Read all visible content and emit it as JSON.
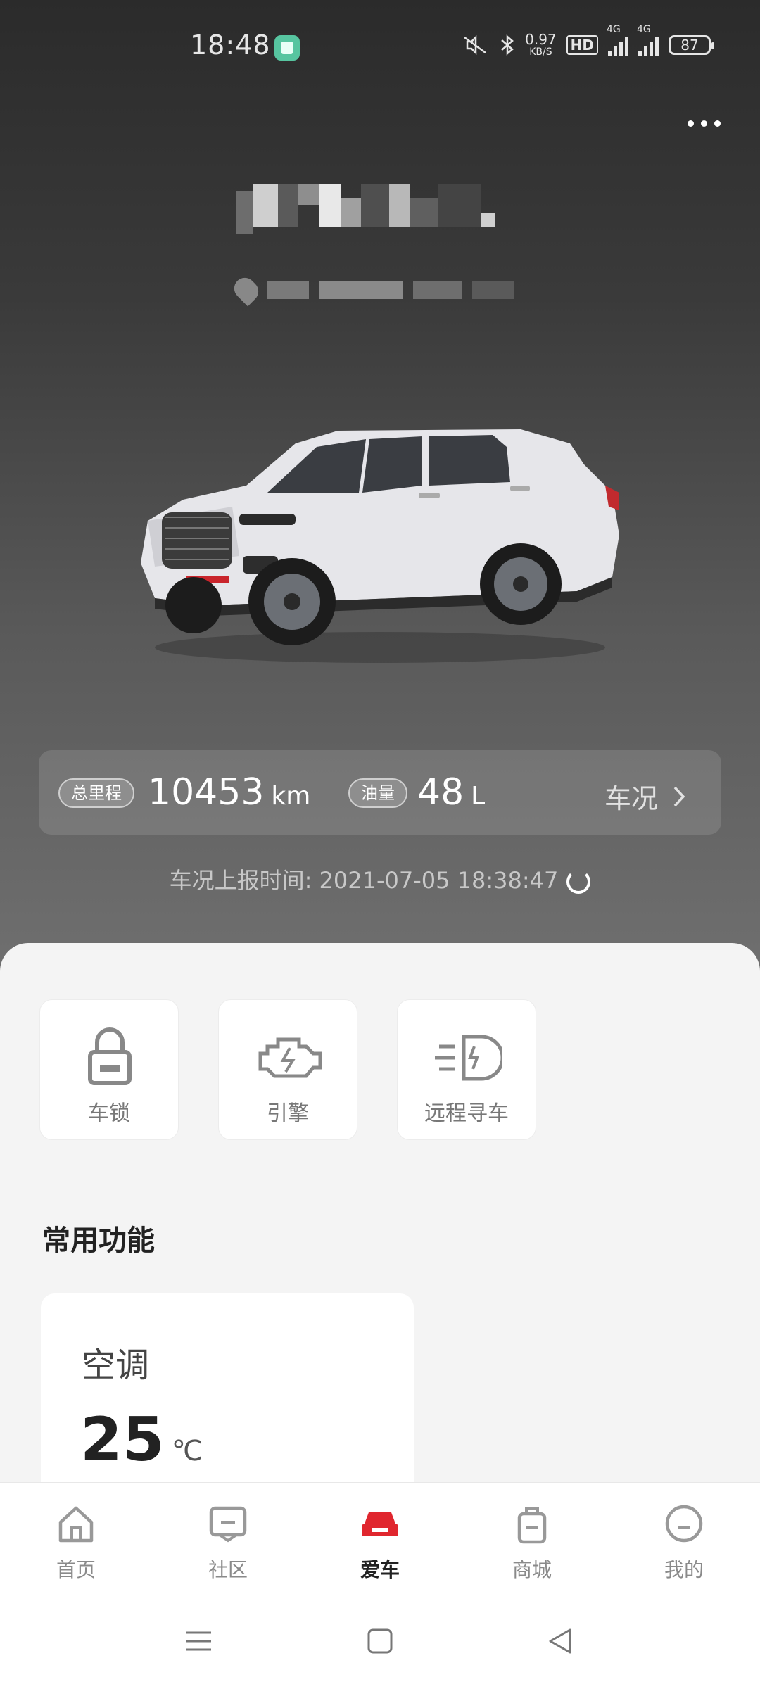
{
  "status_bar": {
    "time": "18:48",
    "speed_value": "0.97",
    "speed_unit": "KB/S",
    "hd_label": "HD",
    "net1": "4G",
    "net2": "4G",
    "battery": "87"
  },
  "stats": {
    "mileage_label": "总里程",
    "mileage_value": "10453",
    "mileage_unit": "km",
    "fuel_label": "油量",
    "fuel_value": "48",
    "fuel_unit": "L",
    "condition_label": "车况"
  },
  "report": {
    "text": "车况上报时间: 2021-07-05 18:38:47"
  },
  "quick_actions": [
    {
      "label": "车锁",
      "icon": "lock-icon"
    },
    {
      "label": "引擎",
      "icon": "engine-icon"
    },
    {
      "label": "远程寻车",
      "icon": "headlight-icon"
    }
  ],
  "common": {
    "title": "常用功能",
    "ac_title": "空调",
    "ac_temp": "25",
    "ac_unit": "℃"
  },
  "tabs": [
    {
      "label": "首页",
      "icon": "home-icon"
    },
    {
      "label": "社区",
      "icon": "community-icon"
    },
    {
      "label": "爱车",
      "icon": "car-icon"
    },
    {
      "label": "商城",
      "icon": "shop-bag-icon"
    },
    {
      "label": "我的",
      "icon": "profile-icon"
    }
  ],
  "colors": {
    "accent": "#e0262e",
    "header_dark": "#2b2b2b"
  }
}
